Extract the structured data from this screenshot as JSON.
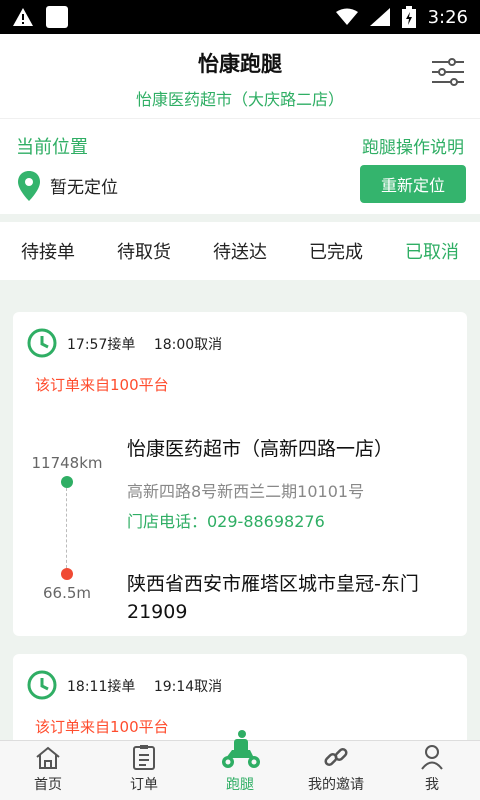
{
  "status_bar": {
    "time": "3:26"
  },
  "header": {
    "title": "怡康跑腿",
    "subtitle": "怡康医药超市（大庆路二店）"
  },
  "location": {
    "label": "当前位置",
    "help": "跑腿操作说明",
    "status": "暂无定位",
    "relocate_button": "重新定位"
  },
  "tabs": [
    {
      "label": "待接单",
      "active": false
    },
    {
      "label": "待取货",
      "active": false
    },
    {
      "label": "待送达",
      "active": false
    },
    {
      "label": "已完成",
      "active": false
    },
    {
      "label": "已取消",
      "active": true
    }
  ],
  "orders": [
    {
      "accepted_time": "17:57接单",
      "cancelled_time": "18:00取消",
      "platform_note": "该订单来自100平台",
      "store_distance": "11748km",
      "store_name": "怡康医药超市（高新四路一店）",
      "store_address": "高新四路8号新西兰二期10101号",
      "store_phone": "门店电话：029-88698276",
      "dest_distance": "66.5m",
      "dest_address": "陕西省西安市雁塔区城市皇冠-东门21909"
    },
    {
      "accepted_time": "18:11接单",
      "cancelled_time": "19:14取消",
      "platform_note": "该订单来自100平台"
    }
  ],
  "bottom_nav": [
    {
      "label": "首页",
      "icon": "home-icon"
    },
    {
      "label": "订单",
      "icon": "clipboard-icon"
    },
    {
      "label": "跑腿",
      "icon": "scooter-icon"
    },
    {
      "label": "我的邀请",
      "icon": "link-icon"
    },
    {
      "label": "我",
      "icon": "person-icon"
    }
  ],
  "colors": {
    "accent": "#2fae64",
    "warning": "#ff4d2e"
  }
}
